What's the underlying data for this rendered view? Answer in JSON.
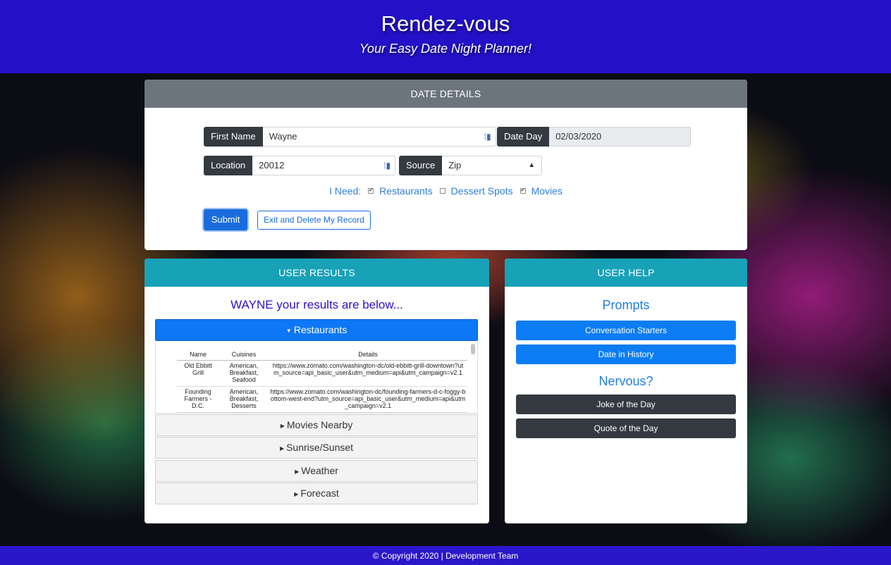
{
  "header": {
    "title": "Rendez-vous",
    "subtitle": "Your Easy Date Night Planner!"
  },
  "details": {
    "heading": "DATE DETAILS",
    "first_name_label": "First Name",
    "first_name_value": "Wayne",
    "date_day_label": "Date Day",
    "date_day_value": "02/03/2020",
    "location_label": "Location",
    "location_value": "20012",
    "source_label": "Source",
    "source_value": "Zip",
    "need_label": "I Need:",
    "needs": [
      {
        "label": "Restaurants",
        "checked": true
      },
      {
        "label": "Dessert Spots",
        "checked": false
      },
      {
        "label": "Movies",
        "checked": true
      }
    ],
    "submit_label": "Submit",
    "exit_label": "Exit and Delete My Record"
  },
  "results": {
    "heading": "USER RESULTS",
    "greeting": "WAYNE your results are below...",
    "sections": [
      "Restaurants",
      "Movies Nearby",
      "Sunrise/Sunset",
      "Weather",
      "Forecast"
    ],
    "table_headers": [
      "Name",
      "Cuisines",
      "Details"
    ],
    "rows": [
      {
        "name": "Old Ebbitt Grill",
        "cuisines": "American, Breakfast, Seafood",
        "details": "https://www.zomato.com/washington-dc/old-ebbitt-grill-downtown?utm_source=api_basic_user&utm_medium=api&utm_campaign=v2.1"
      },
      {
        "name": "Founding Farmers - D.C.",
        "cuisines": "American, Breakfast, Desserts",
        "details": "https://www.zomato.com/washington-dc/founding-farmers-d-c-foggy-bottom-west-end?utm_source=api_basic_user&utm_medium=api&utm_campaign=v2.1"
      }
    ]
  },
  "help": {
    "heading": "USER HELP",
    "prompts_title": "Prompts",
    "conversation_label": "Conversation Starters",
    "history_label": "Date in History",
    "nervous_title": "Nervous?",
    "joke_label": "Joke of the Day",
    "quote_label": "Quote of the Day"
  },
  "footer": {
    "text": "© Copyright 2020 | Development Team"
  },
  "colors": {
    "brand": "#2211c6",
    "primary": "#0d7df5",
    "info": "#17a2b8",
    "dark": "#343a40"
  }
}
